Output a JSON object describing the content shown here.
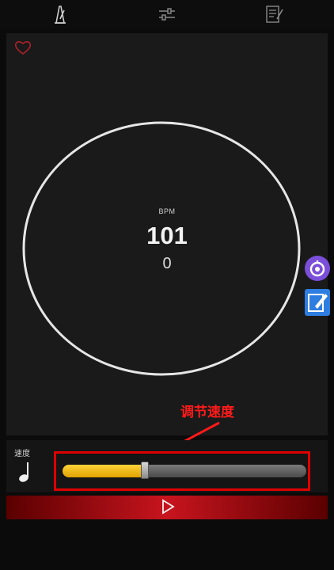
{
  "tabs": [
    {
      "name": "metronome-icon"
    },
    {
      "name": "sliders-icon"
    },
    {
      "name": "notes-icon"
    }
  ],
  "favorite": {
    "icon": "heart-icon",
    "color": "#b0202a"
  },
  "dial": {
    "bpm_label": "BPM",
    "bpm_value": "101",
    "beat_count": "0"
  },
  "side_buttons": [
    {
      "icon": "assistive-ball-icon",
      "color": "#7b4fd9"
    },
    {
      "icon": "pencil-note-icon",
      "color": "#2e7de0"
    }
  ],
  "annotation": {
    "text": "调节速度",
    "color": "#ff1a1a"
  },
  "speed": {
    "label": "速度",
    "icon": "quarter-note-icon",
    "slider_fraction": 0.33,
    "fill_color": "#ffd23a"
  },
  "play": {
    "icon": "play-icon",
    "color": "#c8141e"
  }
}
